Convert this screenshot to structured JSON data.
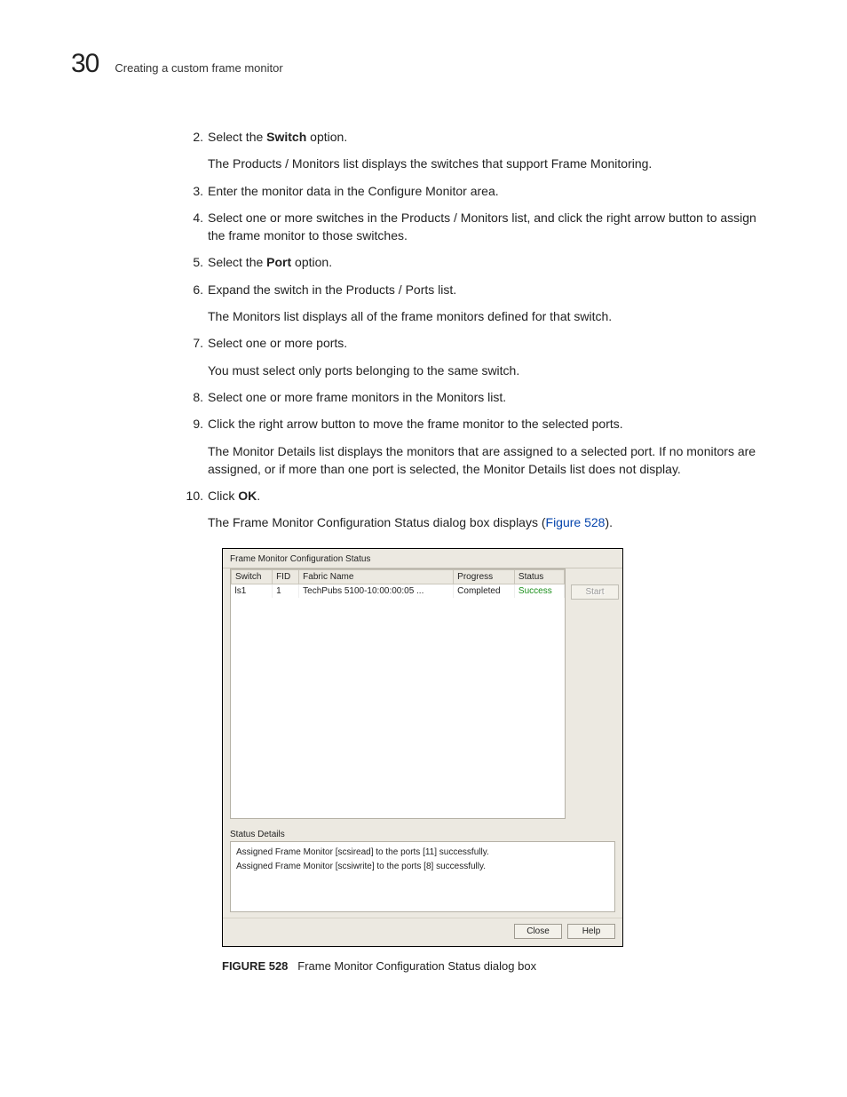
{
  "header": {
    "number": "30",
    "title": "Creating a custom frame monitor"
  },
  "steps": [
    {
      "num": "2",
      "lead_a": "Select the ",
      "bold": "Switch",
      "lead_b": " option.",
      "para": "The Products / Monitors list displays the switches that support Frame Monitoring."
    },
    {
      "num": "3",
      "lead_a": "Enter the monitor data in the Configure Monitor area.",
      "bold": "",
      "lead_b": "",
      "para": ""
    },
    {
      "num": "4",
      "lead_a": "Select one or more switches in the Products / Monitors list, and click the right arrow button to assign the frame monitor to those switches.",
      "bold": "",
      "lead_b": "",
      "para": ""
    },
    {
      "num": "5",
      "lead_a": "Select the ",
      "bold": "Port",
      "lead_b": " option.",
      "para": ""
    },
    {
      "num": "6",
      "lead_a": "Expand the switch in the Products / Ports list.",
      "bold": "",
      "lead_b": "",
      "para": "The Monitors list displays all of the frame monitors defined for that switch."
    },
    {
      "num": "7",
      "lead_a": "Select one or more ports.",
      "bold": "",
      "lead_b": "",
      "para": "You must select only ports belonging to the same switch."
    },
    {
      "num": "8",
      "lead_a": "Select one or more frame monitors in the Monitors list.",
      "bold": "",
      "lead_b": "",
      "para": ""
    },
    {
      "num": "9",
      "lead_a": "Click the right arrow button to move the frame monitor to the selected ports.",
      "bold": "",
      "lead_b": "",
      "para": "The Monitor Details list displays the monitors that are assigned to a selected port. If no monitors are assigned, or if more than one port is selected, the Monitor Details list does not display."
    },
    {
      "num": "10",
      "lead_a": "Click ",
      "bold": "OK",
      "lead_b": ".",
      "para_pre": "The Frame Monitor Configuration Status dialog box displays (",
      "para_link": "Figure 528",
      "para_post": ")."
    }
  ],
  "dialog": {
    "title": "Frame Monitor Configuration Status",
    "columns": [
      "Switch",
      "FID",
      "Fabric Name",
      "Progress",
      "Status"
    ],
    "row": {
      "switch": "ls1",
      "fid": "1",
      "fabric": "TechPubs 5100-10:00:00:05 ...",
      "progress": "Completed",
      "status": "Success"
    },
    "start_btn": "Start",
    "details_label": "Status Details",
    "details": [
      "Assigned Frame Monitor [scsiread] to the ports [11] successfully.",
      "Assigned Frame Monitor [scsiwrite] to the ports [8] successfully."
    ],
    "close_btn": "Close",
    "help_btn": "Help"
  },
  "figure": {
    "label": "FIGURE 528",
    "caption": "Frame Monitor Configuration Status dialog box"
  }
}
